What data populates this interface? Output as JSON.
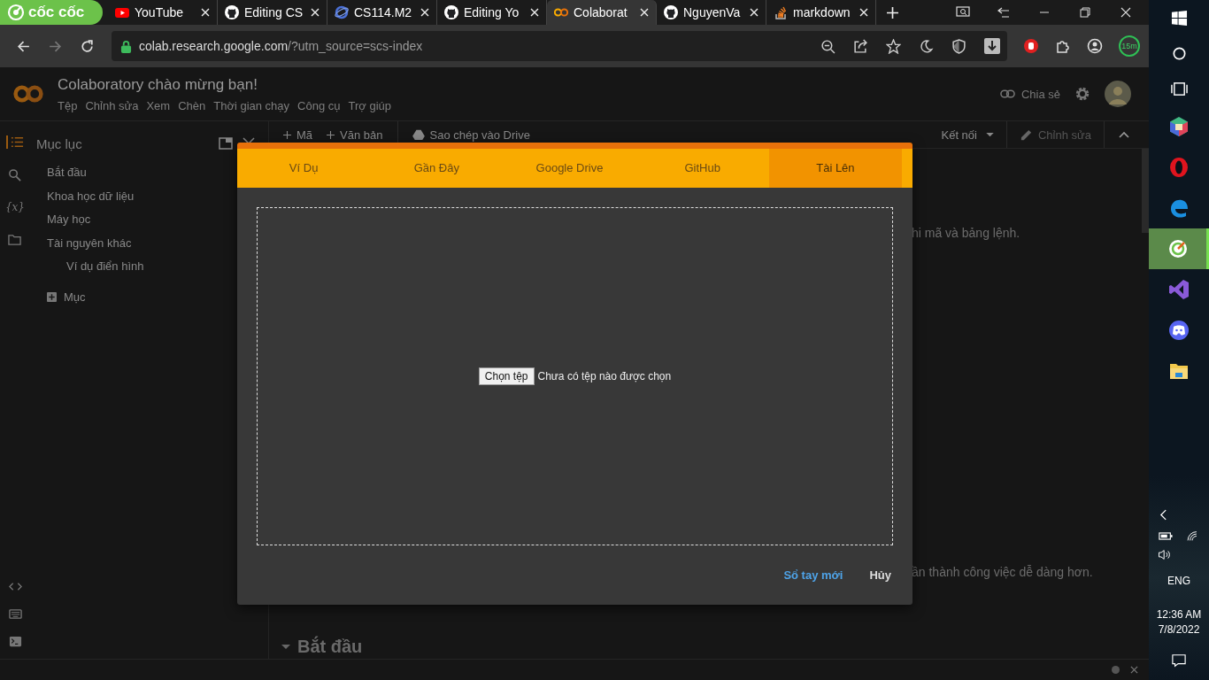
{
  "browser": {
    "logo": "cốc cốc",
    "tabs": [
      {
        "title": "YouTube",
        "kind": "youtube",
        "selected": false
      },
      {
        "title": "Editing CS",
        "kind": "github",
        "selected": false
      },
      {
        "title": "CS114.M2",
        "kind": "globe",
        "selected": false
      },
      {
        "title": "Editing Yo",
        "kind": "github",
        "selected": false
      },
      {
        "title": "Colaborat",
        "kind": "colab",
        "selected": true
      },
      {
        "title": "NguyenVa",
        "kind": "github",
        "selected": false
      },
      {
        "title": "markdown",
        "kind": "stack",
        "selected": false
      }
    ],
    "url_host": "colab.research.google.com",
    "url_path": "/?utm_source=scs-index",
    "timer_badge": "15m"
  },
  "colab": {
    "title": "Colaboratory chào mừng bạn!",
    "menu": [
      "Tệp",
      "Chỉnh sửa",
      "Xem",
      "Chèn",
      "Thời gian chạy",
      "Công cụ",
      "Trợ giúp"
    ],
    "share": "Chia sẻ"
  },
  "toolbar": {
    "add_code": "Mã",
    "add_text": "Văn bản",
    "copy_to_drive": "Sao chép vào Drive",
    "connect": "Kết nối",
    "edit": "Chỉnh sửa"
  },
  "sidebar": {
    "variables_label": "{x}",
    "title": "Mục lục",
    "items": [
      {
        "label": "Bắt đầu"
      },
      {
        "label": "Khoa học dữ liệu"
      },
      {
        "label": "Máy học"
      },
      {
        "label": "Tài nguyên khác",
        "children": [
          {
            "label": "Ví dụ điển hình"
          }
        ]
      }
    ],
    "add_section": "Mục"
  },
  "notebook": {
    "text_1": "hi mã và bảng lệnh.",
    "text_2": "ần thành công việc dễ dàng hơn.",
    "heading": "Bắt đầu"
  },
  "dialog": {
    "tabs": [
      {
        "label": "Ví Dụ",
        "selected": false
      },
      {
        "label": "Gần Đây",
        "selected": false
      },
      {
        "label": "Google Drive",
        "selected": false
      },
      {
        "label": "GitHub",
        "selected": false
      },
      {
        "label": "Tài Lên",
        "selected": true
      }
    ],
    "file_button": "Chọn tệp",
    "file_status": "Chưa có tệp nào được chọn",
    "buttons": [
      {
        "label": "Sổ tay mới",
        "kind": "primary"
      },
      {
        "label": "Hủy",
        "kind": "plain"
      }
    ]
  },
  "taskbar": {
    "apps": [
      {
        "kind": "cube",
        "selected": false
      },
      {
        "kind": "opera",
        "selected": false
      },
      {
        "kind": "edge",
        "selected": false
      },
      {
        "kind": "coccoc",
        "selected": true
      },
      {
        "kind": "studio",
        "selected": false
      },
      {
        "kind": "discord",
        "selected": false
      },
      {
        "kind": "folder",
        "selected": false
      }
    ],
    "language": "ENG",
    "time": "12:36 AM",
    "date": "7/8/2022"
  }
}
